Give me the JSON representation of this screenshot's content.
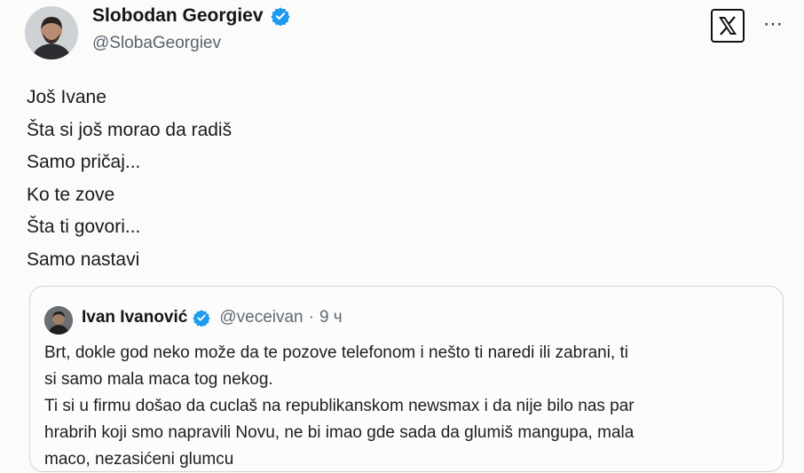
{
  "tweet": {
    "author_name": "Slobodan Georgiev",
    "author_handle": "@SlobaGeorgiev",
    "more_icon": "⋯",
    "lines": [
      "Još Ivane",
      "Šta si još morao da radiš",
      "Samo pričaj...",
      "Ko te zove",
      "Šta ti govori...",
      "Samo nastavi"
    ]
  },
  "quoted": {
    "author_name": "Ivan Ivanović",
    "author_handle": "@veceivan",
    "separator": "·",
    "time": "9 ч",
    "lines": [
      "Brt, dokle god neko može da te pozove telefonom i nešto ti naredi ili zabrani, ti",
      "si samo mala maca tog nekog.",
      "Ti si u firmu došao da cuclaš na republikanskom newsmax i da nije bilo nas par",
      "hrabrih koji smo napravili Novu, ne bi imao gde sada da glumiš mangupa, mala",
      "maco, nezasićeni glumcu"
    ]
  },
  "colors": {
    "verified": "#1d9bf0",
    "text": "#0f1419",
    "muted": "#5f6a73",
    "border": "#cfd4d8"
  }
}
